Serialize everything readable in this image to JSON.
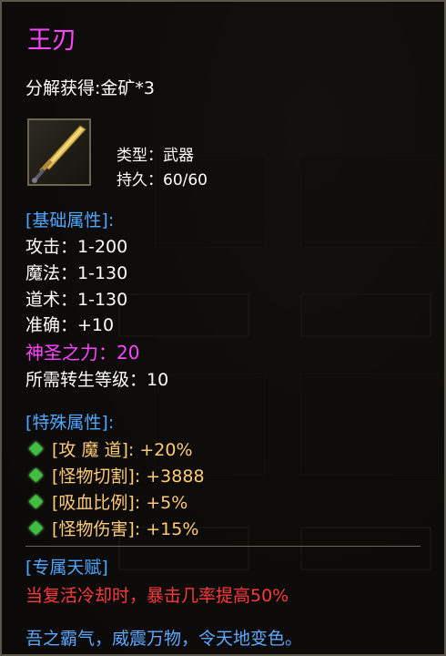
{
  "item": {
    "name": "王刃",
    "decompose": "分解获得:金矿*3",
    "type_line": "类型：武器",
    "durability_line": "持久：60/60"
  },
  "base": {
    "header": "[基础属性]:",
    "attack": "攻击：1-200",
    "magic": "魔法：1-130",
    "taoism": "道术：1-130",
    "accuracy": "准确：+10",
    "holy_power": "神圣之力：20",
    "rebirth_level": "所需转生等级：10"
  },
  "special": {
    "header": "[特殊属性]:",
    "items": [
      "[攻 魔 道]: +20%",
      "[怪物切割]: +3888",
      "[吸血比例]: +5%",
      "[怪物伤害]: +15%"
    ]
  },
  "talent": {
    "header": "[专属天赋]",
    "text": "当复活冷却时，暴击几率提高50%"
  },
  "flavor": "吾之霸气，威震万物，令天地变色。",
  "colors": {
    "title": "#ff44ff",
    "section": "#4fa7ff",
    "special_value": "#ffcc77",
    "talent": "#ff3a3a",
    "gem": "#3fbf3f"
  }
}
